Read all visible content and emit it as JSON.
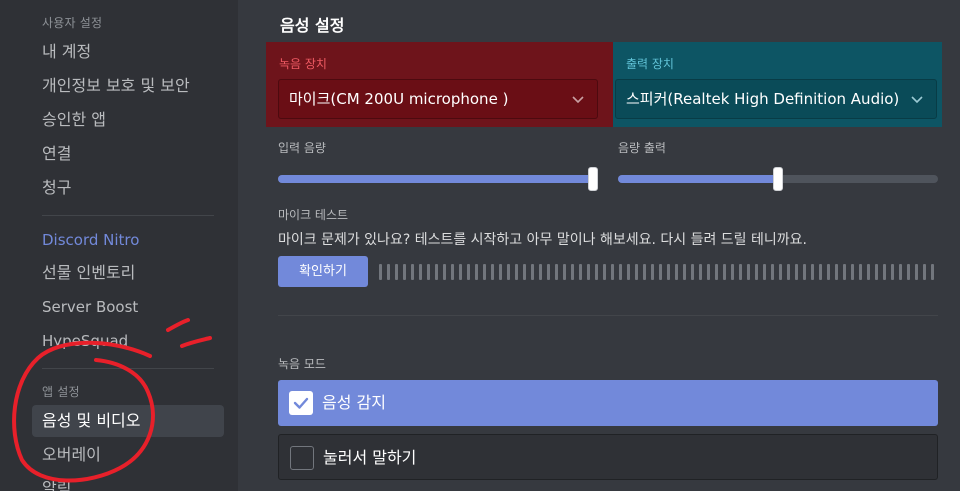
{
  "sidebar": {
    "user_settings_header": "사용자 설정",
    "items_user": [
      {
        "label": "내 계정"
      },
      {
        "label": "개인정보 보호 및 보안"
      },
      {
        "label": "승인한 앱"
      },
      {
        "label": "연결"
      },
      {
        "label": "청구"
      }
    ],
    "items_nitro": [
      {
        "label": "Discord Nitro"
      },
      {
        "label": "선물 인벤토리"
      },
      {
        "label": "Server Boost"
      },
      {
        "label": "HypeSquad"
      }
    ],
    "app_settings_header": "앱 설정",
    "items_app": [
      {
        "label": "음성 및 비디오",
        "active": true
      },
      {
        "label": "오버레이"
      },
      {
        "label": "알림"
      }
    ]
  },
  "main": {
    "title": "음성 설정",
    "input_device": {
      "label": "녹음 장치",
      "value": "마이크(CM 200U microphone )"
    },
    "output_device": {
      "label": "출력 장치",
      "value": "스피커(Realtek High Definition Audio)"
    },
    "input_volume": {
      "label": "입력 음량",
      "value_percent": 100
    },
    "output_volume": {
      "label": "음량 출력",
      "value_percent": 50
    },
    "mic_test": {
      "label": "마이크 테스트",
      "description": "마이크 문제가 있나요? 테스트를 시작하고 아무 말이나 해보세요. 다시 들려 드릴 테니까요.",
      "button": "확인하기"
    },
    "input_mode": {
      "label": "녹음 모드",
      "options": [
        {
          "label": "음성 감지",
          "selected": true
        },
        {
          "label": "눌러서 말하기",
          "selected": false
        }
      ]
    }
  },
  "colors": {
    "accent": "#7289da",
    "input_panel": "#6e141b",
    "output_panel": "#0d5564",
    "scribble": "#e8202a"
  },
  "icons": {
    "chevron": "chevron-down-icon",
    "check": "checkmark-icon"
  }
}
